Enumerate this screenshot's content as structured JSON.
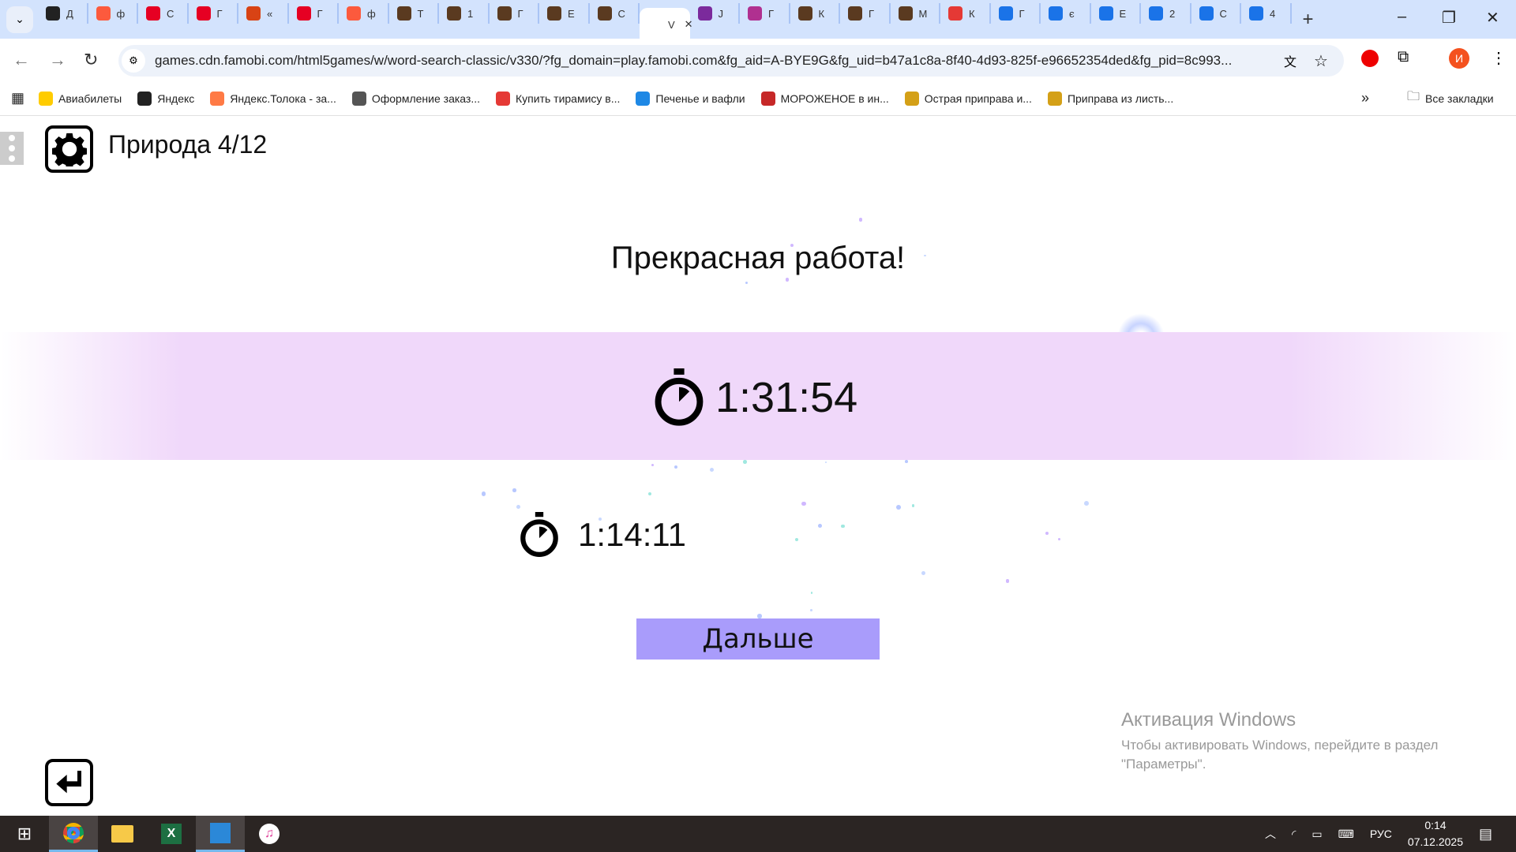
{
  "browser": {
    "tabs": [
      {
        "label": "Д",
        "color": "#222"
      },
      {
        "label": "ф",
        "color": "#fc5a3d"
      },
      {
        "label": "С",
        "color": "#e60023"
      },
      {
        "label": "Г",
        "color": "#e60023"
      },
      {
        "label": "«",
        "color": "#d84315"
      },
      {
        "label": "Г",
        "color": "#e60023"
      },
      {
        "label": "ф",
        "color": "#fc5a3d"
      },
      {
        "label": "Т",
        "color": "#5a3a20"
      },
      {
        "label": "1",
        "color": "#5a3a20"
      },
      {
        "label": "Г",
        "color": "#5a3a20"
      },
      {
        "label": "Е",
        "color": "#5a3a20"
      },
      {
        "label": "С",
        "color": "#5a3a20"
      },
      {
        "label": "V",
        "color": "#fff",
        "active": true
      },
      {
        "label": "J",
        "color": "#7b2a9c"
      },
      {
        "label": "Г",
        "color": "#b03090"
      },
      {
        "label": "К",
        "color": "#5a3a20"
      },
      {
        "label": "Г",
        "color": "#5a3a20"
      },
      {
        "label": "М",
        "color": "#5a3a20"
      },
      {
        "label": "К",
        "color": "#e53935"
      },
      {
        "label": "Г",
        "color": "#1a73e8"
      },
      {
        "label": "є",
        "color": "#1a73e8"
      },
      {
        "label": "Е",
        "color": "#1a73e8"
      },
      {
        "label": "2",
        "color": "#1a73e8"
      },
      {
        "label": "С",
        "color": "#1a73e8"
      },
      {
        "label": "4",
        "color": "#1a73e8"
      }
    ],
    "url": "games.cdn.famobi.com/html5games/w/word-search-classic/v330/?fg_domain=play.famobi.com&fg_aid=A-BYE9G&fg_uid=b47a1c8a-8f40-4d93-825f-e96652354ded&fg_pid=8c993...",
    "profile_initial": "И",
    "bookmarks": [
      {
        "label": "Авиабилеты",
        "color": "#ffcc00"
      },
      {
        "label": "Яндекс",
        "color": "#222"
      },
      {
        "label": "Яндекс.Толока - за...",
        "color": "#ff7a45"
      },
      {
        "label": "Оформление заказ...",
        "color": "#555"
      },
      {
        "label": "Купить тирамису в...",
        "color": "#e53935"
      },
      {
        "label": "Печенье и вафли",
        "color": "#1e88e5"
      },
      {
        "label": "МОРОЖЕНОЕ в ин...",
        "color": "#c62828"
      },
      {
        "label": "Острая приправа и...",
        "color": "#d4a017"
      },
      {
        "label": "Приправа из листь...",
        "color": "#d4a017"
      }
    ],
    "all_bookmarks": "Все закладки"
  },
  "game": {
    "level_title": "Природа 4/12",
    "headline": "Прекрасная работа!",
    "current_time": "1:31:54",
    "best_time": "1:14:11",
    "next_button": "Дальше",
    "accent": "#a99cfb"
  },
  "watermark": {
    "title": "Активация Windows",
    "text": "Чтобы активировать Windows, перейдите в раздел \"Параметры\"."
  },
  "taskbar": {
    "language": "РУС",
    "time": "0:14",
    "date": "07.12.2025"
  }
}
